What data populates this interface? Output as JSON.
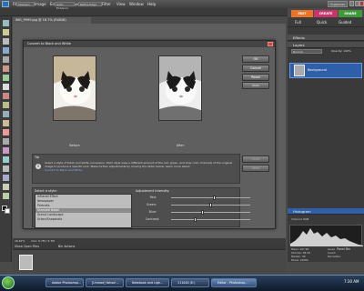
{
  "menubar": {
    "items": [
      "File",
      "Edit",
      "Image",
      "Enhance",
      "Layer",
      "Select",
      "Filter",
      "View",
      "Window",
      "Help"
    ],
    "organizer_label": "Organizer"
  },
  "options_bar": {
    "field1": "Sharpen",
    "field2": "Auto-Enhance",
    "field3": "Refine Edge"
  },
  "mode_tabs": {
    "edit": "EDIT",
    "create": "CREATE",
    "share": "SHARE"
  },
  "sub_tabs": {
    "full": "Full",
    "quick": "Quick",
    "guided": "Guided"
  },
  "document": {
    "tab_title": "IMG_9999.jpg @ 16.7% (RGB/8)",
    "status": "16.67%",
    "status_detail": "Doc: 5.7M / 5.7M"
  },
  "dialog": {
    "title": "Convert to Black and White",
    "before_caption": "Before",
    "after_caption": "After",
    "buttons": {
      "ok": "OK",
      "cancel": "Cancel",
      "reset": "Reset",
      "undo": "Undo",
      "redo": "Redo"
    },
    "tip_label": "Tip",
    "tip_text": "Select a style of black and white conversion. Each style uses a different amount of the red, green, and blue color channels of the original image to produce a specific look. Make further adjustments by moving the slider below. Learn more about:",
    "tip_link": "Convert to Black and White",
    "style_label": "Select a style:",
    "styles": [
      "Infrared Effect",
      "Newspaper",
      "Portraits",
      "Scanned Detail",
      "Scenic Landscape",
      "Urban/Snapshots"
    ],
    "selected_style_index": 3,
    "adjust_label": "Adjustment Intensity:",
    "adjustments": [
      {
        "name": "Red:",
        "value": 0.55
      },
      {
        "name": "Green:",
        "value": 0.5
      },
      {
        "name": "Blue:",
        "value": 0.4
      },
      {
        "name": "Contrast:",
        "value": 0.3
      }
    ]
  },
  "panels": {
    "effects": "Effects",
    "layers": "Layers",
    "blend_mode": "Normal",
    "opacity_label": "Opacity: 100%",
    "layer_name": "Background",
    "histogram": "Histogram",
    "channel_label": "Channel: RGB"
  },
  "histogram_stats": {
    "mean": "Mean: 107.90",
    "std": "Std Dev: 58.59",
    "median": "Median: 99",
    "pixels": "Pixels: 24084",
    "level": "Level:",
    "count": "Count:",
    "percentile": "Percentile:"
  },
  "project_bin": {
    "tab1": "Show Open Files",
    "tab2": "Bin Actions",
    "panel_bin": "Panel Bin"
  },
  "taskbar": {
    "tasks": [
      "Adobe Photoshop...",
      "[Unread] Yahoo!...",
      "Notebook and Ligh...",
      "111040 (E:)",
      "Editor - Photoshop..."
    ],
    "active_index": 4,
    "time": "7:30 AM"
  },
  "colors": {
    "accent_blue": "#2e5fa8",
    "edit_tab": "#e8742a",
    "create_tab": "#c9356b",
    "share_tab": "#3f9a3a"
  }
}
